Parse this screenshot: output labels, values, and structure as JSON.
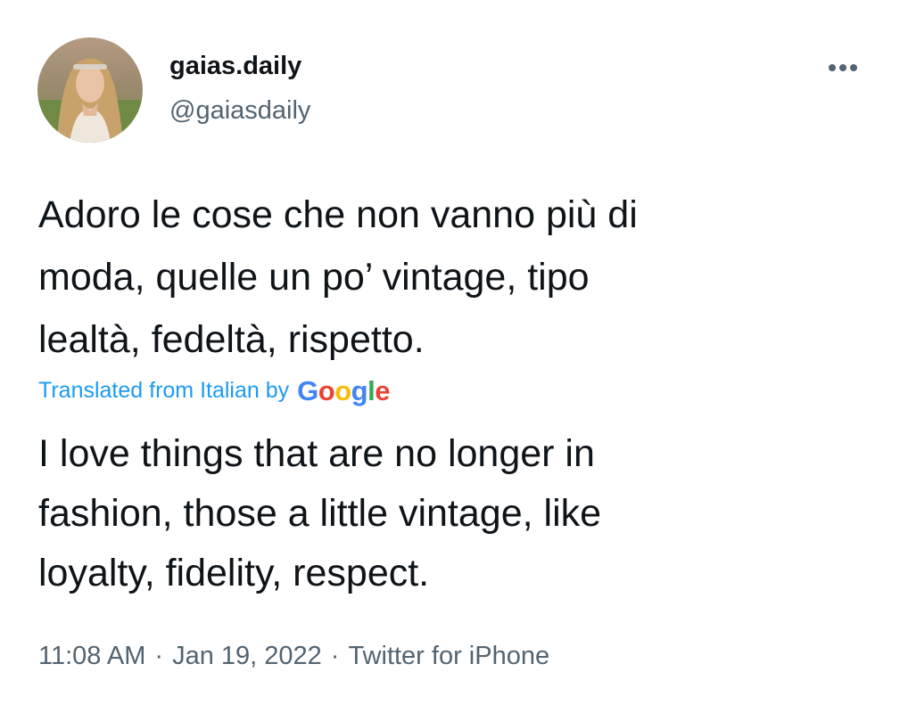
{
  "user": {
    "display_name": "gaias.daily",
    "handle": "@gaiasdaily"
  },
  "tweet": {
    "text": "Adoro le cose che non vanno più di\nmoda, quelle un po’ vintage, tipo\nlealtà, fedeltà, rispetto.",
    "translated_label": "Translated from Italian by",
    "translation_provider": "Google",
    "translation": "I love things that are no longer in\nfashion, those a little vintage, like\nloyalty, fidelity, respect."
  },
  "meta": {
    "time": "11:08 AM",
    "separator": "·",
    "date": "Jan 19, 2022",
    "source": "Twitter for iPhone"
  },
  "colors": {
    "accent": "#1d9bf0",
    "text_primary": "#0f1419",
    "text_secondary": "#536471",
    "google_blue": "#4285f4",
    "google_red": "#ea4335",
    "google_yellow": "#fbbc05",
    "google_green": "#34a853"
  },
  "icons": {
    "more": "more-horizontal-icon"
  }
}
